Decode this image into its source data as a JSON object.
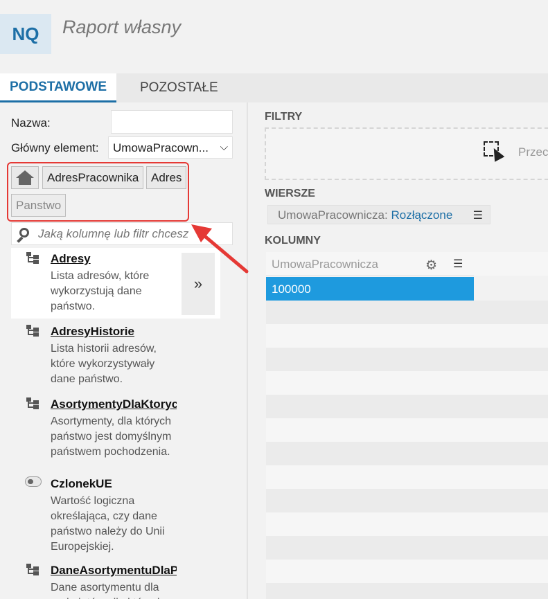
{
  "header": {
    "logo": "NQ",
    "title": "Raport własny"
  },
  "tabs": [
    {
      "label": "PODSTAWOWE",
      "active": true
    },
    {
      "label": "POZOSTAŁE",
      "active": false
    }
  ],
  "form": {
    "name_label": "Nazwa:",
    "name_value": "",
    "main_element_label": "Główny element:",
    "main_element_value": "UmowaPracown...",
    "chevron": "⌵"
  },
  "breadcrumbs": [
    {
      "label": "",
      "icon": "home-icon"
    },
    {
      "label": "AdresPracownika"
    },
    {
      "label": "Adres"
    },
    {
      "label": "Panstwo",
      "disabled": true
    }
  ],
  "search": {
    "placeholder": "Jaką kolumnę lub filtr chcesz"
  },
  "list": {
    "more_label": "»",
    "items": [
      {
        "name": "Adresy",
        "icon": "tree-icon",
        "description": "Lista adresów, które wykorzystują dane państwo.",
        "selected": true
      },
      {
        "name": "AdresyHistorie",
        "icon": "tree-icon",
        "description": "Lista historii adresów, które wykorzystywały dane państwo."
      },
      {
        "name": "AsortymentyDlaKtoryc",
        "icon": "tree-icon",
        "description": "Asortymenty, dla których państwo jest domyślnym państwem pochodzenia."
      },
      {
        "name": "CzlonekUE",
        "icon": "toggle-icon",
        "description": "Wartość logiczna określająca, czy dane państwo należy do Unii Europejskiej."
      },
      {
        "name": "DaneAsortymentuDlaP",
        "icon": "tree-icon",
        "description": "Dane asortymentu dla podmiotów, dla których"
      }
    ]
  },
  "right": {
    "filters_label": "FILTRY",
    "drop_text": "Przec",
    "rows_label": "WIERSZE",
    "row_chip": {
      "name": "UmowaPracownicza:",
      "state": "Rozłączone",
      "menu": "☰"
    },
    "columns_label": "KOLUMNY",
    "column_header": "UmowaPracownicza",
    "gear": "⚙",
    "menu": "☰",
    "selected_value": "100000"
  },
  "colors": {
    "accent": "#1d6fa6",
    "selection": "#1e9ade",
    "annotation": "#e53935"
  }
}
